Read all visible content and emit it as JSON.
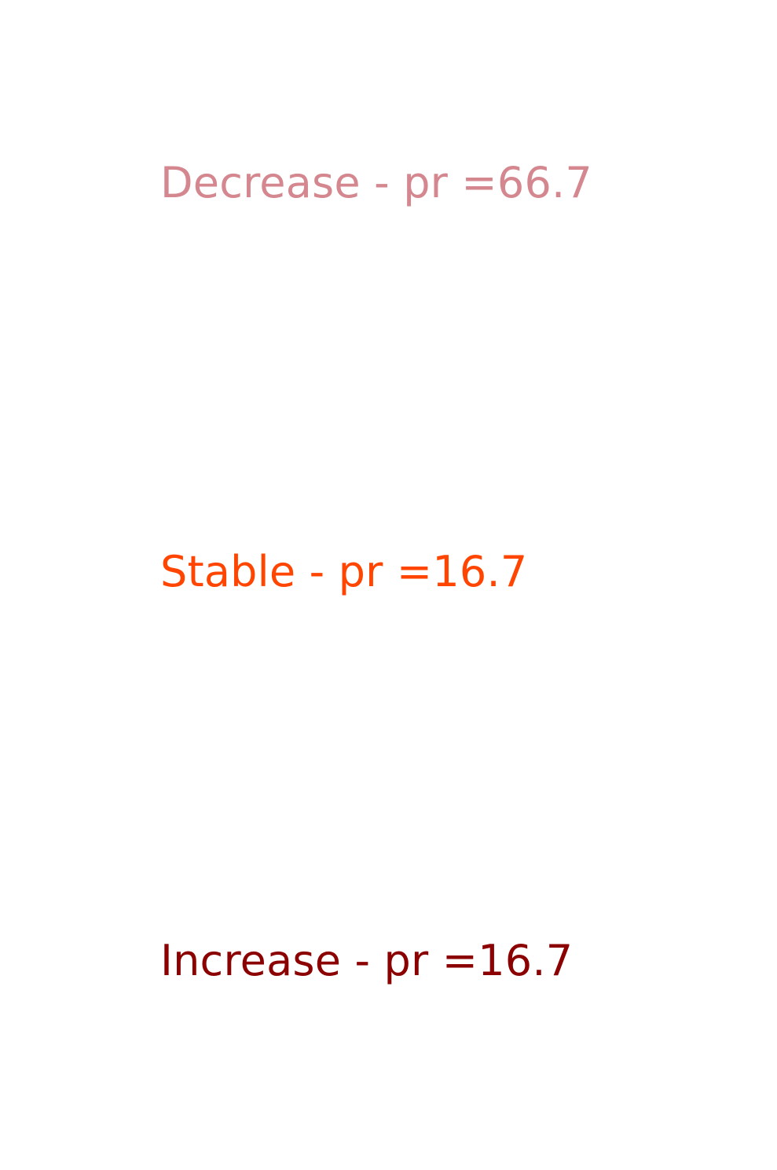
{
  "labels": {
    "decrease": {
      "text": "Decrease - pr =66.7",
      "color": "#d4878f"
    },
    "stable": {
      "text": "Stable - pr =16.7",
      "color": "#ff4500"
    },
    "increase": {
      "text": "Increase - pr =16.7",
      "color": "#8b0000"
    }
  }
}
